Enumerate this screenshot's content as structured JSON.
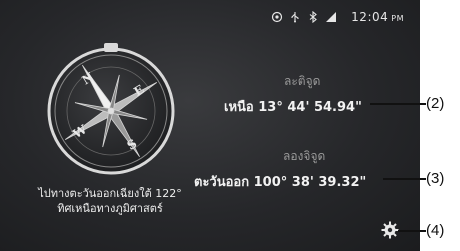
{
  "status": {
    "time": "12:04",
    "ampm": "PM",
    "icons": [
      "location-icon",
      "usb-icon",
      "bluetooth-icon",
      "signal-icon"
    ]
  },
  "compass": {
    "letters": {
      "n": "N",
      "e": "E",
      "s": "S",
      "w": "W"
    },
    "heading_text_line1": "ไปทางตะวันออกเฉียงใต้ 122°",
    "heading_text_line2": "ทิศเหนือทางภูมิศาสตร์"
  },
  "latitude": {
    "label": "ละติจูด",
    "value": "เหนือ 13° 44' 54.94\""
  },
  "longitude": {
    "label": "ลองจิจูด",
    "value": "ตะวันออก 100° 38' 39.32\""
  },
  "settings": {
    "icon": "gear-icon"
  },
  "callouts": {
    "c2": "(2)",
    "c3": "(3)",
    "c4": "(4)"
  }
}
